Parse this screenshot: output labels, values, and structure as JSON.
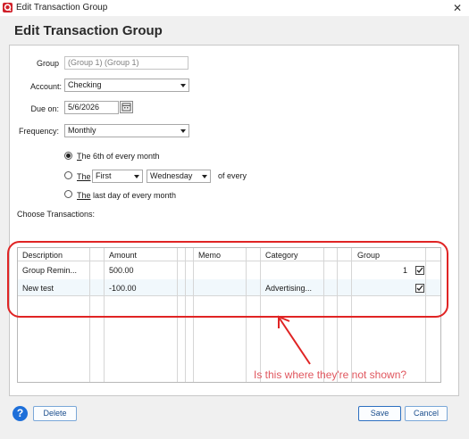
{
  "window": {
    "title": "Edit Transaction Group",
    "close_glyph": "✕"
  },
  "heading": "Edit Transaction Group",
  "form": {
    "group_label": "Group",
    "group_value": "(Group  1) (Group  1)",
    "account_label": "Account:",
    "account_value": "Checking",
    "due_label": "Due on:",
    "due_value": "5/6/2026",
    "frequency_label": "Frequency:",
    "frequency_value": "Monthly",
    "option1_prefix": "T",
    "option1_rest": "he 6th of every month",
    "option2_prefix": "The",
    "option2_first": "First",
    "option2_day": "Wednesday",
    "option2_suffix": "of every",
    "option3_prefix": "The",
    "option3_rest": " last day of every month",
    "selected_option": 1,
    "choose_label": "Choose Transactions:"
  },
  "table": {
    "headers": {
      "description": "Description",
      "amount": "Amount",
      "memo": "Memo",
      "category": "Category",
      "group": "Group"
    },
    "rows": [
      {
        "description": "Group Remin...",
        "amount": "500.00",
        "memo": "",
        "category": "",
        "group": "1",
        "checked": true
      },
      {
        "description": "New test",
        "amount": "-100.00",
        "memo": "",
        "category": "Advertising...",
        "group": "",
        "checked": true
      }
    ]
  },
  "annotation": {
    "text": "Is this where they're not shown?",
    "color": "#e02424"
  },
  "buttons": {
    "help": "?",
    "delete": "Delete",
    "save": "Save",
    "cancel": "Cancel"
  },
  "icons": [
    "app-logo-icon",
    "close-icon",
    "calendar-icon",
    "chevron-down-icon",
    "help-icon",
    "checkbox-check-icon",
    "arrow-icon"
  ]
}
